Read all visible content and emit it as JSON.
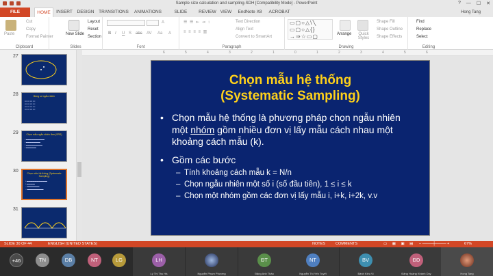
{
  "window": {
    "title": "Sample size calculation and sampling-SDH [Compatibility Mode] - PowerPoint",
    "user": "Hong Tang",
    "controls": [
      "?",
      "—",
      "☐",
      "✕"
    ]
  },
  "tabs": [
    "FILE",
    "HOME",
    "INSERT",
    "DESIGN",
    "TRANSITIONS",
    "ANIMATIONS",
    "SLIDE SHOW",
    "REVIEW",
    "VIEW",
    "EndNote X8",
    "ACROBAT"
  ],
  "ribbon": {
    "clipboard": {
      "paste": "Paste",
      "cut": "Cut",
      "copy": "Copy",
      "format_painter": "Format Painter",
      "label": "Clipboard"
    },
    "slides": {
      "new_slide": "New Slide",
      "layout": "Layout",
      "reset": "Reset",
      "section": "Section",
      "label": "Slides"
    },
    "font": {
      "label": "Font",
      "bold": "B",
      "italic": "I",
      "underline": "U",
      "strike": "S",
      "abc": "abc",
      "av": "AV",
      "aa": "Aa",
      "a": "A"
    },
    "paragraph": {
      "text_direction": "Text Direction",
      "align_text": "Align Text",
      "convert_smartart": "Convert to SmartArt",
      "label": "Paragraph"
    },
    "drawing": {
      "arrange": "Arrange",
      "quick_styles": "Quick Styles",
      "shape_fill": "Shape Fill",
      "shape_outline": "Shape Outline",
      "shape_effects": "Shape Effects",
      "label": "Drawing",
      "shapes": "▭▢○△\\╲\n▭▢○△{}\n→⇒☆▭▢"
    },
    "editing": {
      "find": "Find",
      "replace": "Replace",
      "select": "Select",
      "label": "Editing"
    }
  },
  "ruler_marks": [
    "6",
    "5",
    "4",
    "3",
    "2",
    "1",
    "0",
    "1",
    "2",
    "3",
    "4",
    "5",
    "6"
  ],
  "thumbnails": [
    {
      "num": "27",
      "text": ""
    },
    {
      "num": "28",
      "text": "Bảng số ngẫu nhiên"
    },
    {
      "num": "29",
      "text": "Chọn mẫu ngẫu nhiên đơn (SRS)"
    },
    {
      "num": "30",
      "text": "Chọn mẫu hệ thống (Systematic Sampling)"
    },
    {
      "num": "31",
      "text": ""
    }
  ],
  "slide": {
    "title_line1": "Chọn mẫu hệ thống",
    "title_line2": "(Systematic Sampling)",
    "bullet1_a": "Chọn mẫu hệ thống là phương pháp chọn ngẫu nhiên một ",
    "bullet1_u": "nhóm",
    "bullet1_b": " gồm nhiều đơn vị lấy mẫu cách nhau một khoảng cách mẫu (k).",
    "bullet2": "Gồm các bước",
    "sub1": "Tính khoảng cách mẫu k = N/n",
    "sub2": "Chọn ngẫu nhiên một số i (số đầu tiên), 1 ≤ i ≤ k",
    "sub3": "Chọn một nhóm gồm các đơn vị lấy mẫu i, i+k, i+2k, v.v",
    "bullet_char": "•",
    "dash_char": "–"
  },
  "status": {
    "slide_of": "SLIDE 30 OF 44",
    "language": "ENGLISH (UNITED STATES)",
    "notes": "NOTES",
    "comments": "COMMENTS",
    "zoom": "67%"
  },
  "participants": [
    {
      "initials": "+46",
      "name": "",
      "color": "#4a4a4a"
    },
    {
      "initials": "TN",
      "name": "",
      "color": "#8e8e8e"
    },
    {
      "initials": "DB",
      "name": "",
      "color": "#5b7fa6"
    },
    {
      "initials": "NT",
      "name": "",
      "color": "#c0607a"
    },
    {
      "initials": "LG",
      "name": "",
      "color": "#b79a3a"
    },
    {
      "initials": "LH",
      "name": "Lý Thị Thu Hà",
      "color": "#9c5fa8"
    },
    {
      "initials": "",
      "name": "Nguyễn Phạm Phương",
      "color": "#3d6e8f"
    },
    {
      "initials": "ĐT",
      "name": "Đặng Anh Thảo",
      "color": "#5a8f4a"
    },
    {
      "initials": "NT",
      "name": "Nguyễn Thị Yến Tuyết",
      "color": "#4f7fc0"
    },
    {
      "initials": "BV",
      "name": "Bành Kiều Vi",
      "color": "#3e8fb0"
    },
    {
      "initials": "ĐD",
      "name": "Đặng Hoàng Khánh Duy",
      "color": "#c0607a"
    },
    {
      "initials": "",
      "name": "Hong Tang",
      "color": "#c0502a"
    }
  ]
}
